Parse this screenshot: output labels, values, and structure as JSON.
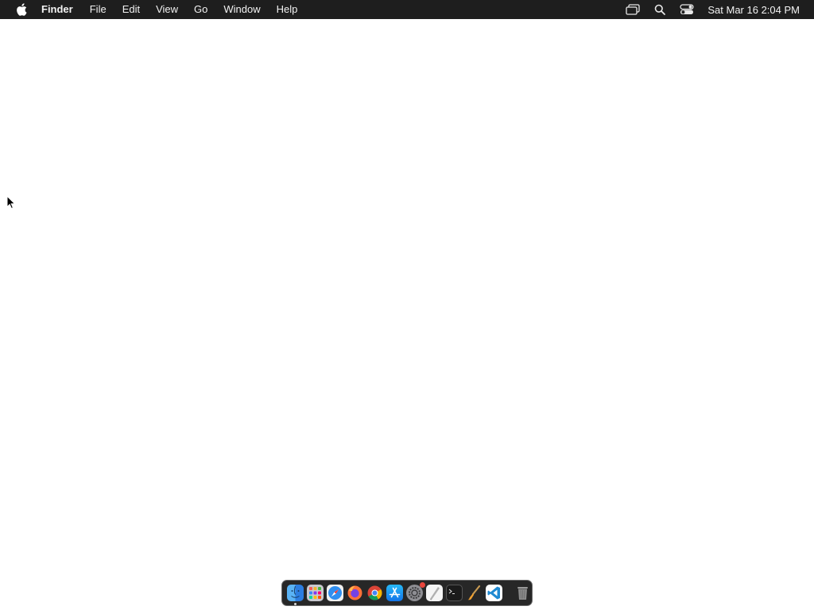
{
  "menubar": {
    "app_name": "Finder",
    "menus": [
      "File",
      "Edit",
      "View",
      "Go",
      "Window",
      "Help"
    ],
    "status_icons": [
      "screen-mirroring-icon",
      "search-icon",
      "control-center-icon"
    ],
    "clock": "Sat Mar 16  2:04 PM"
  },
  "dock": {
    "apps": [
      {
        "name": "Finder",
        "icon": "finder-icon",
        "running": true
      },
      {
        "name": "Launchpad",
        "icon": "launchpad-icon"
      },
      {
        "name": "Safari",
        "icon": "safari-icon"
      },
      {
        "name": "Firefox",
        "icon": "firefox-icon"
      },
      {
        "name": "Chrome",
        "icon": "chrome-icon"
      },
      {
        "name": "App Store",
        "icon": "app-store-icon"
      },
      {
        "name": "System Settings",
        "icon": "system-settings-icon",
        "badge": true
      },
      {
        "name": "Pages",
        "icon": "pages-icon"
      },
      {
        "name": "Terminal",
        "icon": "terminal-icon"
      },
      {
        "name": "Paintbrush",
        "icon": "paintbrush-icon"
      },
      {
        "name": "Visual Studio Code",
        "icon": "vscode-icon"
      }
    ],
    "trash": {
      "name": "Trash",
      "icon": "trash-icon"
    }
  },
  "colors": {
    "menubar_bg": "#1e1e1e",
    "desktop_bg": "#ffffff",
    "dock_bg": "#1e1e1e"
  }
}
